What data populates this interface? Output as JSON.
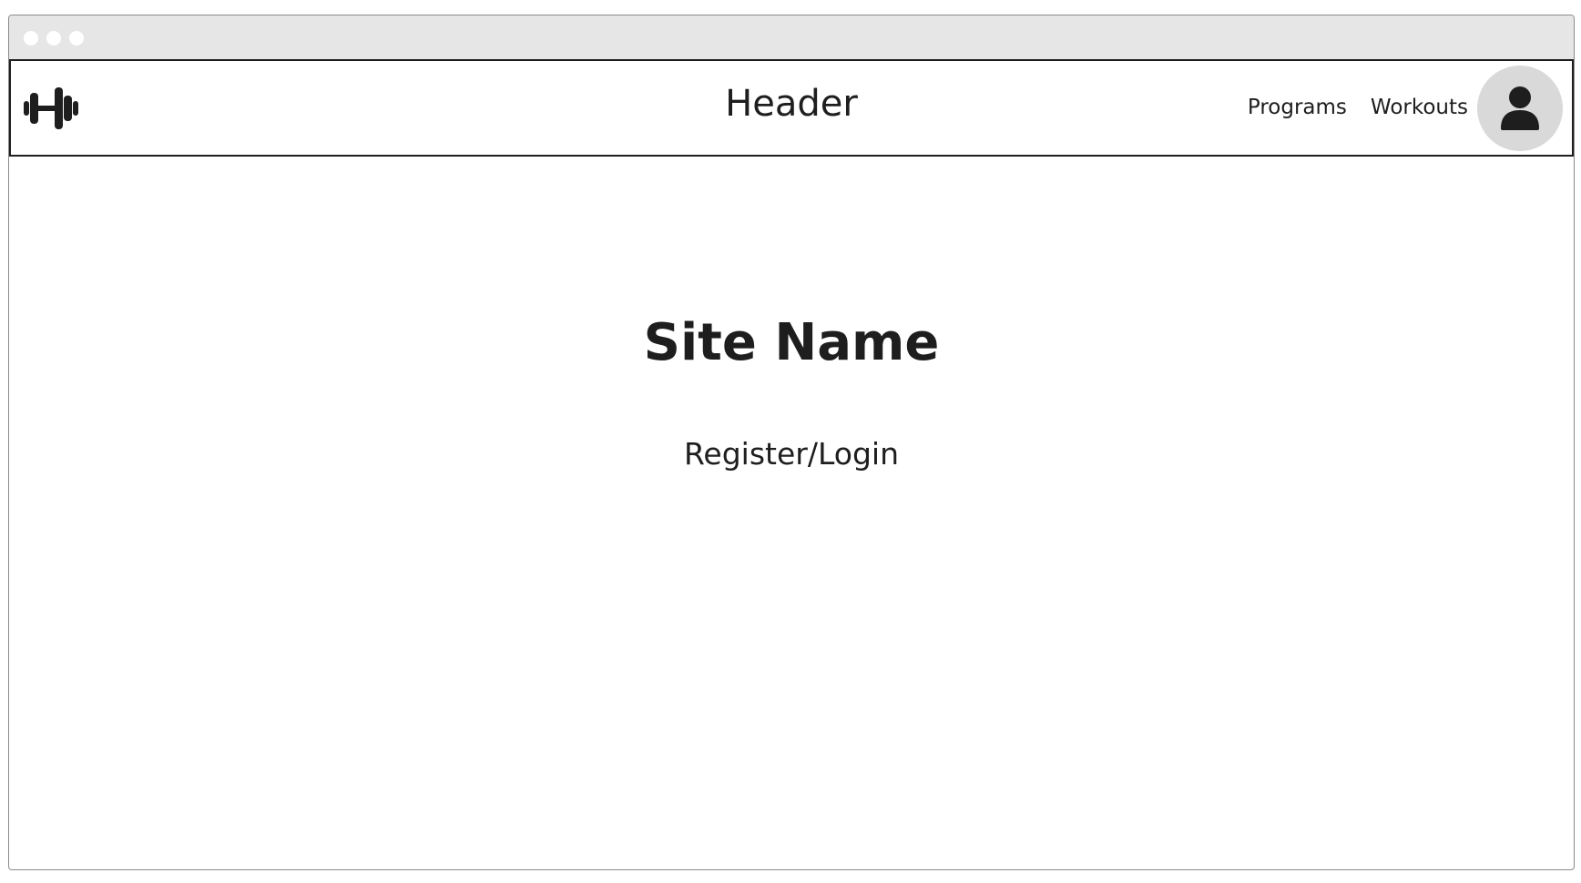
{
  "header": {
    "title": "Header",
    "logo_icon": "dumbbell-icon",
    "nav": [
      {
        "label": "Programs"
      },
      {
        "label": "Workouts"
      }
    ],
    "avatar_icon": "user-icon"
  },
  "main": {
    "site_name": "Site Name",
    "register_login": "Register/Login"
  },
  "colors": {
    "titlebar": "#e6e6e6",
    "text": "#1e1e1e",
    "avatar_bg": "#d9d9d9",
    "window_border": "#8a8a8a"
  }
}
